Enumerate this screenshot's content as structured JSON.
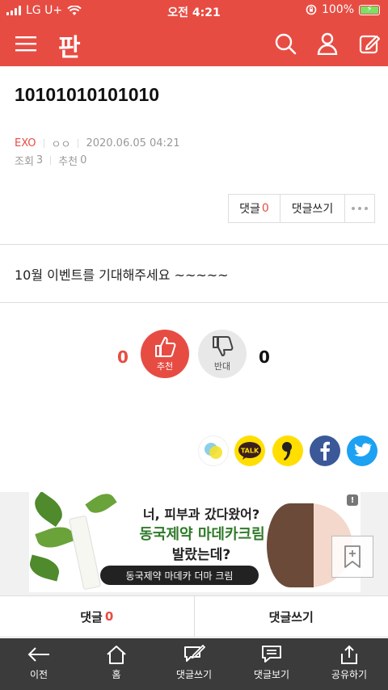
{
  "status_bar": {
    "carrier": "LG U+",
    "time": "오전 4:21",
    "battery": "100%"
  },
  "app": {
    "logo": "판"
  },
  "post": {
    "title": "10101010101010",
    "category": "EXO",
    "author": "ㅇㅇ",
    "date": "2020.06.05 04:21",
    "views_label": "조회",
    "views": "3",
    "recommend_label": "추천",
    "recommend": "0",
    "body": "10월 이벤트를 기대해주세요 ~~~~~"
  },
  "actions": {
    "comment_label": "댓글",
    "comment_count": "0",
    "write_comment_label": "댓글쓰기"
  },
  "votes": {
    "up_count": "0",
    "up_label": "추천",
    "down_count": "0",
    "down_label": "반대"
  },
  "share": {
    "talk_label": "TALK"
  },
  "ad": {
    "line1": "너, 피부과 갔다왔어?",
    "line2": "동국제약 마데카크림",
    "line3": "발랐는데?",
    "pill": "동국제약 마데카 더마 크림",
    "info": "!"
  },
  "comment_bar": {
    "comment_label": "댓글",
    "comment_count": "0",
    "write_label": "댓글쓰기"
  },
  "bottom_nav": {
    "items": [
      {
        "label": "이전",
        "icon": "back-arrow-icon"
      },
      {
        "label": "홈",
        "icon": "home-icon"
      },
      {
        "label": "댓글쓰기",
        "icon": "write-comment-icon"
      },
      {
        "label": "댓글보기",
        "icon": "view-comments-icon"
      },
      {
        "label": "공유하기",
        "icon": "share-icon"
      }
    ]
  },
  "colors": {
    "brand": "#e74c43",
    "nav_bg": "#3b3b3b",
    "facebook": "#3b5998",
    "twitter": "#1da1f2",
    "kakao": "#ffde00"
  }
}
